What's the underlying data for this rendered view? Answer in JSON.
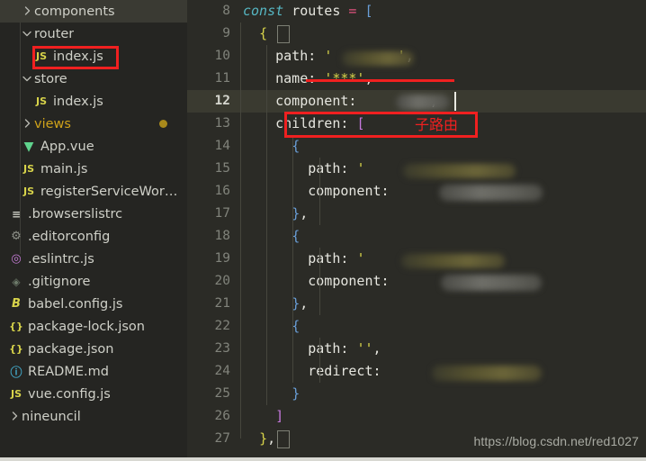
{
  "sidebar": {
    "items": [
      {
        "label": "components",
        "icon": "chevron-right-icon",
        "icon_kind": "chevron-closed",
        "indent": 1,
        "selected": true,
        "modified": false,
        "color": "default"
      },
      {
        "label": "router",
        "icon": "chevron-down-icon",
        "icon_kind": "chevron-open",
        "indent": 1,
        "selected": false,
        "modified": false,
        "color": "default"
      },
      {
        "label": "index.js",
        "icon": "js-file-icon",
        "icon_kind": "js",
        "indent": 2,
        "selected": false,
        "modified": false,
        "color": "default"
      },
      {
        "label": "store",
        "icon": "chevron-down-icon",
        "icon_kind": "chevron-open",
        "indent": 1,
        "selected": false,
        "modified": false,
        "color": "default"
      },
      {
        "label": "index.js",
        "icon": "js-file-icon",
        "icon_kind": "js",
        "indent": 2,
        "selected": false,
        "modified": false,
        "color": "default"
      },
      {
        "label": "views",
        "icon": "chevron-right-icon",
        "icon_kind": "chevron-closed",
        "indent": 1,
        "selected": false,
        "modified": true,
        "color": "modified"
      },
      {
        "label": "App.vue",
        "icon": "vue-file-icon",
        "icon_kind": "vue",
        "indent": 1,
        "selected": false,
        "modified": false,
        "color": "default"
      },
      {
        "label": "main.js",
        "icon": "js-file-icon",
        "icon_kind": "js",
        "indent": 1,
        "selected": false,
        "modified": false,
        "color": "default"
      },
      {
        "label": "registerServiceWor…",
        "icon": "js-file-icon",
        "icon_kind": "js",
        "indent": 1,
        "selected": false,
        "modified": false,
        "color": "default"
      },
      {
        "label": ".browserslistrc",
        "icon": "list-file-icon",
        "icon_kind": "list",
        "indent": 0,
        "selected": false,
        "modified": false,
        "color": "default"
      },
      {
        "label": ".editorconfig",
        "icon": "gear-icon",
        "icon_kind": "gear",
        "indent": 0,
        "selected": false,
        "modified": false,
        "color": "default"
      },
      {
        "label": ".eslintrc.js",
        "icon": "eslint-icon",
        "icon_kind": "eslint",
        "indent": 0,
        "selected": false,
        "modified": false,
        "color": "default"
      },
      {
        "label": ".gitignore",
        "icon": "git-icon",
        "icon_kind": "git",
        "indent": 0,
        "selected": false,
        "modified": false,
        "color": "default"
      },
      {
        "label": "babel.config.js",
        "icon": "babel-icon",
        "icon_kind": "babel",
        "indent": 0,
        "selected": false,
        "modified": false,
        "color": "default"
      },
      {
        "label": "package-lock.json",
        "icon": "json-file-icon",
        "icon_kind": "json",
        "indent": 0,
        "selected": false,
        "modified": false,
        "color": "default"
      },
      {
        "label": "package.json",
        "icon": "json-file-icon",
        "icon_kind": "json",
        "indent": 0,
        "selected": false,
        "modified": false,
        "color": "default"
      },
      {
        "label": "README.md",
        "icon": "info-icon",
        "icon_kind": "md",
        "indent": 0,
        "selected": false,
        "modified": false,
        "color": "default"
      },
      {
        "label": "vue.config.js",
        "icon": "js-file-icon",
        "icon_kind": "js",
        "indent": 0,
        "selected": false,
        "modified": false,
        "color": "default"
      },
      {
        "label": "nineuncil",
        "icon": "chevron-right-icon",
        "icon_kind": "chevron-closed",
        "indent": 0,
        "selected": false,
        "modified": false,
        "color": "default"
      }
    ]
  },
  "editor": {
    "active_line": 12,
    "first_line_number": 8,
    "lines": [
      {
        "num": 8,
        "tokens": [
          {
            "t": "const",
            "c": "kw"
          },
          {
            "t": " ",
            "c": "punct"
          },
          {
            "t": "routes",
            "c": "ident"
          },
          {
            "t": " ",
            "c": "punct"
          },
          {
            "t": "=",
            "c": "op"
          },
          {
            "t": " ",
            "c": "punct"
          },
          {
            "t": "[",
            "c": "brk"
          }
        ]
      },
      {
        "num": 9,
        "tokens": [
          {
            "t": "  ",
            "c": "punct"
          },
          {
            "t": "{",
            "c": "brace"
          }
        ]
      },
      {
        "num": 10,
        "tokens": [
          {
            "t": "    ",
            "c": "punct"
          },
          {
            "t": "path",
            "c": "prop"
          },
          {
            "t": ": ",
            "c": "punct"
          },
          {
            "t": "'",
            "c": "str"
          },
          {
            "t": "        ",
            "c": "punct"
          },
          {
            "t": "'",
            "c": "str"
          },
          {
            "t": ",",
            "c": "punct"
          }
        ]
      },
      {
        "num": 11,
        "tokens": [
          {
            "t": "    ",
            "c": "punct"
          },
          {
            "t": "name",
            "c": "prop"
          },
          {
            "t": ": ",
            "c": "punct"
          },
          {
            "t": "'***'",
            "c": "str"
          },
          {
            "t": ",",
            "c": "punct"
          }
        ]
      },
      {
        "num": 12,
        "tokens": [
          {
            "t": "    ",
            "c": "punct"
          },
          {
            "t": "component",
            "c": "prop"
          },
          {
            "t": ": ",
            "c": "punct"
          },
          {
            "t": "        ",
            "c": "punct"
          },
          {
            "t": ",",
            "c": "punct"
          }
        ]
      },
      {
        "num": 13,
        "tokens": [
          {
            "t": "    ",
            "c": "punct"
          },
          {
            "t": "children",
            "c": "prop"
          },
          {
            "t": ": ",
            "c": "punct"
          },
          {
            "t": "[",
            "c": "brace2"
          }
        ]
      },
      {
        "num": 14,
        "tokens": [
          {
            "t": "      ",
            "c": "punct"
          },
          {
            "t": "{",
            "c": "brace3"
          }
        ]
      },
      {
        "num": 15,
        "tokens": [
          {
            "t": "        ",
            "c": "punct"
          },
          {
            "t": "path",
            "c": "prop"
          },
          {
            "t": ": ",
            "c": "punct"
          },
          {
            "t": "'",
            "c": "str"
          }
        ]
      },
      {
        "num": 16,
        "tokens": [
          {
            "t": "        ",
            "c": "punct"
          },
          {
            "t": "component",
            "c": "prop"
          },
          {
            "t": ": ",
            "c": "punct"
          }
        ]
      },
      {
        "num": 17,
        "tokens": [
          {
            "t": "      ",
            "c": "punct"
          },
          {
            "t": "}",
            "c": "brace3"
          },
          {
            "t": ",",
            "c": "punct"
          }
        ]
      },
      {
        "num": 18,
        "tokens": [
          {
            "t": "      ",
            "c": "punct"
          },
          {
            "t": "{",
            "c": "brace3"
          }
        ]
      },
      {
        "num": 19,
        "tokens": [
          {
            "t": "        ",
            "c": "punct"
          },
          {
            "t": "path",
            "c": "prop"
          },
          {
            "t": ": ",
            "c": "punct"
          },
          {
            "t": "'",
            "c": "str"
          }
        ]
      },
      {
        "num": 20,
        "tokens": [
          {
            "t": "        ",
            "c": "punct"
          },
          {
            "t": "component",
            "c": "prop"
          },
          {
            "t": ": ",
            "c": "punct"
          }
        ]
      },
      {
        "num": 21,
        "tokens": [
          {
            "t": "      ",
            "c": "punct"
          },
          {
            "t": "}",
            "c": "brace3"
          },
          {
            "t": ",",
            "c": "punct"
          }
        ]
      },
      {
        "num": 22,
        "tokens": [
          {
            "t": "      ",
            "c": "punct"
          },
          {
            "t": "{",
            "c": "brace3"
          }
        ]
      },
      {
        "num": 23,
        "tokens": [
          {
            "t": "        ",
            "c": "punct"
          },
          {
            "t": "path",
            "c": "prop"
          },
          {
            "t": ": ",
            "c": "punct"
          },
          {
            "t": "''",
            "c": "str"
          },
          {
            "t": ",",
            "c": "punct"
          }
        ]
      },
      {
        "num": 24,
        "tokens": [
          {
            "t": "        ",
            "c": "punct"
          },
          {
            "t": "redirect",
            "c": "prop"
          },
          {
            "t": ": ",
            "c": "punct"
          }
        ]
      },
      {
        "num": 25,
        "tokens": [
          {
            "t": "      ",
            "c": "punct"
          },
          {
            "t": "}",
            "c": "brace3"
          }
        ]
      },
      {
        "num": 26,
        "tokens": [
          {
            "t": "    ",
            "c": "punct"
          },
          {
            "t": "]",
            "c": "brace2"
          }
        ]
      },
      {
        "num": 27,
        "tokens": [
          {
            "t": "  ",
            "c": "punct"
          },
          {
            "t": "}",
            "c": "brace"
          },
          {
            "t": ",",
            "c": "punct"
          }
        ]
      }
    ]
  },
  "annotations": {
    "children_box_label": "children: [",
    "children_note": "子路由",
    "strikethrough_target": "name: '***',",
    "index_js_box_label": "index.js"
  },
  "watermark": {
    "url": "https://blog.csdn.net/red1027"
  },
  "colors": {
    "editor_bg": "#2b2b26",
    "sidebar_bg": "#252522",
    "annotation_red": "#f02020",
    "active_line_bg": "#3a3a30",
    "modified_gold": "#cfa21a",
    "keyword_cyan": "#56b6c2",
    "string_yellow": "#d7d34a"
  }
}
